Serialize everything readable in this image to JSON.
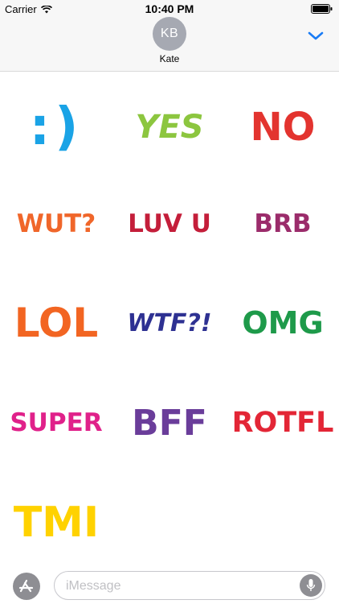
{
  "status_bar": {
    "carrier": "Carrier",
    "time": "10:40 PM"
  },
  "header": {
    "avatar_initials": "KB",
    "contact_name": "Kate",
    "collapse_icon": "chevron-down-icon"
  },
  "stickers": [
    {
      "text": ":)",
      "color": "#1aa3e6"
    },
    {
      "text": "YES",
      "color": "#8cc63f"
    },
    {
      "text": "NO",
      "color": "#e3342f"
    },
    {
      "text": "WUT?",
      "color": "#f0662a"
    },
    {
      "text": "LUV U",
      "color": "#c41e3a"
    },
    {
      "text": "BRB",
      "color": "#9b2c6b"
    },
    {
      "text": "LOL",
      "color": "#f26522"
    },
    {
      "text": "WTF?!",
      "color": "#2e3192"
    },
    {
      "text": "OMG",
      "color": "#1e9a4a"
    },
    {
      "text": "SUPER",
      "color": "#e0218a"
    },
    {
      "text": "BFF",
      "color": "#6a3d9a"
    },
    {
      "text": "ROTFL",
      "color": "#e32636"
    },
    {
      "text": "TMI",
      "color": "#ffd200"
    }
  ],
  "input_bar": {
    "placeholder": "iMessage",
    "app_store_icon": "app-store-icon",
    "mic_icon": "microphone-icon"
  }
}
